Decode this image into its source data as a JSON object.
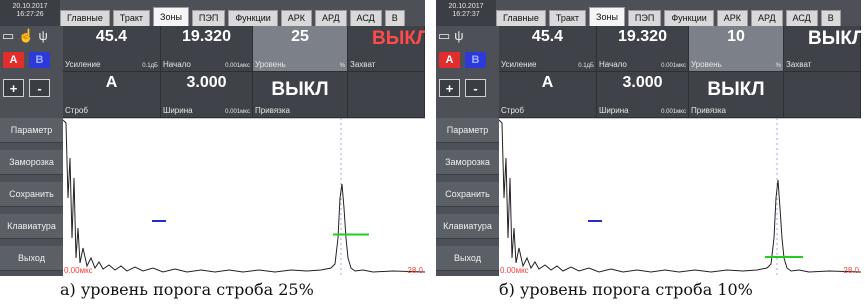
{
  "panels": [
    {
      "datetime_date": "20.10.2017",
      "datetime_time": "16:27:26",
      "tabs": [
        "Главные",
        "Тракт",
        "Зоны",
        "ПЭП",
        "Функции",
        "АРК",
        "АРД",
        "АСД",
        "В"
      ],
      "active_tab": "Зоны",
      "btn_a": "A",
      "btn_b": "B",
      "btn_plus": "+",
      "btn_minus": "-",
      "side": [
        "Параметр",
        "Заморозка",
        "Сохранить",
        "Клавиатура",
        "Выход"
      ],
      "gain": {
        "value": "45.4",
        "label": "Усиление",
        "unit": "0.1дБ"
      },
      "start": {
        "value": "19.320",
        "label": "Начало",
        "unit": "0.001мкс"
      },
      "level": {
        "value": "25",
        "label": "Уровень",
        "unit": "%"
      },
      "capture": {
        "value": "ВЫКЛ",
        "label": "Захват"
      },
      "gate": {
        "value": "A",
        "label": "Строб"
      },
      "width": {
        "value": "3.000",
        "label": "Ширина",
        "unit": "0.001мкс"
      },
      "binding": {
        "value": "ВЫКЛ",
        "label": "Привязка"
      },
      "axis_start": "0.00мкс",
      "axis_end": "28.0",
      "gate_level_percent": 25,
      "caption": "а) уровень порога строба 25%"
    },
    {
      "datetime_date": "20.10.2017",
      "datetime_time": "16:27:37",
      "tabs": [
        "Главные",
        "Тракт",
        "Зоны",
        "ПЭП",
        "Функции",
        "АРК",
        "АРД",
        "АСД",
        "В"
      ],
      "active_tab": "Зоны",
      "btn_a": "A",
      "btn_b": "B",
      "btn_plus": "+",
      "btn_minus": "-",
      "side": [
        "Параметр",
        "Заморозка",
        "Сохранить",
        "Клавиатура",
        "Выход"
      ],
      "gain": {
        "value": "45.4",
        "label": "Усиление",
        "unit": "0.1дБ"
      },
      "start": {
        "value": "19.320",
        "label": "Начало",
        "unit": "0.001мкс"
      },
      "level": {
        "value": "10",
        "label": "Уровень",
        "unit": "%"
      },
      "capture": {
        "value": "ВЫКЛ",
        "label": "Захват"
      },
      "gate": {
        "value": "A",
        "label": "Строб"
      },
      "width": {
        "value": "3.000",
        "label": "Ширина",
        "unit": "0.001мкс"
      },
      "binding": {
        "value": "ВЫКЛ",
        "label": "Привязка"
      },
      "axis_start": "0.00мкс",
      "axis_end": "28.0",
      "gate_level_percent": 10,
      "caption": "б) уровень порога строба 10%"
    }
  ],
  "colors": {
    "gate_a_line": "#22cc22",
    "gate_b_line": "#2a2ac8",
    "axis_text": "#ff3b3b",
    "button_a": "#e32d2d",
    "button_b": "#2d39d9"
  },
  "icons": [
    "screen-icon",
    "hand-icon",
    "usb-icon"
  ]
}
